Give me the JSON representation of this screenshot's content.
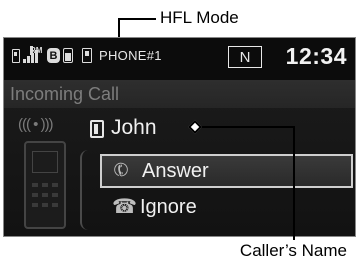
{
  "callouts": {
    "hfl_mode": "HFL Mode",
    "callers_name": "Caller’s Name"
  },
  "status_bar": {
    "rm_label": "RM",
    "bluetooth_label": "B",
    "phone_name": "PHONE#1",
    "mode_indicator": "N",
    "clock": "12:34"
  },
  "screen": {
    "header": "Incoming Call",
    "caller_name": "John",
    "options": [
      {
        "label": "Answer",
        "icon": "phone-answer-icon",
        "selected": true
      },
      {
        "label": "Ignore",
        "icon": "phone-hangup-icon",
        "selected": false
      }
    ]
  },
  "colors": {
    "screen_bg": "#1a1a1a",
    "selected_border": "#cfcfcf",
    "header_text": "#7d7d7d",
    "text": "#f0f0f0"
  }
}
